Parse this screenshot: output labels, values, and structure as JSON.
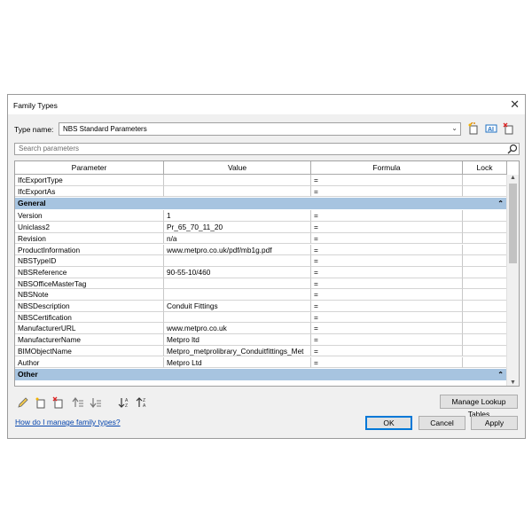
{
  "window": {
    "title": "Family Types",
    "close_glyph": "✕"
  },
  "type_name": {
    "label": "Type name:",
    "value": "NBS Standard Parameters"
  },
  "search": {
    "placeholder": "Search parameters"
  },
  "columns": [
    "Parameter",
    "Value",
    "Formula",
    "Lock"
  ],
  "rows_top": [
    {
      "param": "IfcExportType",
      "value": "",
      "formula": "="
    },
    {
      "param": "IfcExportAs",
      "value": "",
      "formula": "="
    }
  ],
  "group_general": "General",
  "rows_general": [
    {
      "param": "Version",
      "value": "1",
      "formula": "="
    },
    {
      "param": "Uniclass2",
      "value": "Pr_65_70_11_20",
      "formula": "="
    },
    {
      "param": "Revision",
      "value": "n/a",
      "formula": "="
    },
    {
      "param": "ProductInformation",
      "value": "www.metpro.co.uk/pdf/mb1g.pdf",
      "formula": "="
    },
    {
      "param": "NBSTypeID",
      "value": "",
      "formula": "="
    },
    {
      "param": "NBSReference",
      "value": "90-55-10/460",
      "formula": "="
    },
    {
      "param": "NBSOfficeMasterTag",
      "value": "",
      "formula": "="
    },
    {
      "param": "NBSNote",
      "value": "",
      "formula": "="
    },
    {
      "param": "NBSDescription",
      "value": "Conduit Fittings",
      "formula": "="
    },
    {
      "param": "NBSCertification",
      "value": "",
      "formula": "="
    },
    {
      "param": "ManufacturerURL",
      "value": "www.metpro.co.uk",
      "formula": "="
    },
    {
      "param": "ManufacturerName",
      "value": "Metpro ltd",
      "formula": "="
    },
    {
      "param": "BIMObjectName",
      "value": "Metpro_metprolibrary_Conduitfittings_Met",
      "formula": "="
    },
    {
      "param": "Author",
      "value": "Metpro Ltd",
      "formula": "="
    }
  ],
  "group_other": "Other",
  "collapse_glyph": "⌃",
  "buttons": {
    "manage_lookup": "Manage Lookup Tables",
    "ok": "OK",
    "cancel": "Cancel",
    "apply": "Apply"
  },
  "help_link": "How do I manage family types?",
  "icons": {
    "toolbar": [
      "new-type-icon",
      "rename-type-icon",
      "delete-type-icon"
    ],
    "bottom": [
      "edit-parameter-icon",
      "new-parameter-icon",
      "delete-parameter-icon",
      "move-up-icon",
      "move-down-icon",
      "sort-ascending-icon",
      "sort-descending-icon"
    ]
  },
  "colors": {
    "group_header": "#a7c4e0",
    "link": "#0645ad",
    "ok_border": "#0078d7"
  }
}
